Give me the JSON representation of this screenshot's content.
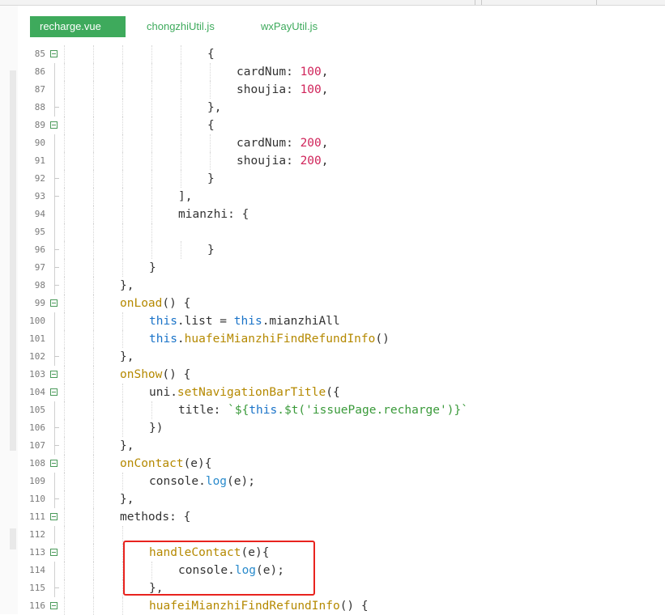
{
  "tabs": [
    {
      "label": "recharge.vue",
      "active": true
    },
    {
      "label": "chongzhiUtil.js",
      "active": false
    },
    {
      "label": "wxPayUtil.js",
      "active": false
    }
  ],
  "colors": {
    "tab_active_bg": "#3eaa5c",
    "number_literal": "#d0245a",
    "keyword_this": "#1a73c8",
    "method_name": "#b58900",
    "call_name": "#2a8bcc",
    "template_string": "#3a9a3a",
    "highlight_box": "#e8231e"
  },
  "editor": {
    "lines": [
      {
        "n": "85",
        "fold": true,
        "indent": 6,
        "tokens": [
          {
            "t": "{",
            "c": "plain"
          }
        ]
      },
      {
        "n": "86",
        "fold": false,
        "indent": 7,
        "tokens": [
          {
            "t": "cardNum: ",
            "c": "plain"
          },
          {
            "t": "100",
            "c": "num"
          },
          {
            "t": ",",
            "c": "plain"
          }
        ]
      },
      {
        "n": "87",
        "fold": false,
        "indent": 7,
        "tokens": [
          {
            "t": "shoujia: ",
            "c": "plain"
          },
          {
            "t": "100",
            "c": "num"
          },
          {
            "t": ",",
            "c": "plain"
          }
        ]
      },
      {
        "n": "88",
        "fold": false,
        "foldend": true,
        "indent": 6,
        "tokens": [
          {
            "t": "},",
            "c": "plain"
          }
        ]
      },
      {
        "n": "89",
        "fold": true,
        "indent": 6,
        "tokens": [
          {
            "t": "{",
            "c": "plain"
          }
        ]
      },
      {
        "n": "90",
        "fold": false,
        "indent": 7,
        "tokens": [
          {
            "t": "cardNum: ",
            "c": "plain"
          },
          {
            "t": "200",
            "c": "num"
          },
          {
            "t": ",",
            "c": "plain"
          }
        ]
      },
      {
        "n": "91",
        "fold": false,
        "indent": 7,
        "tokens": [
          {
            "t": "shoujia: ",
            "c": "plain"
          },
          {
            "t": "200",
            "c": "num"
          },
          {
            "t": ",",
            "c": "plain"
          }
        ]
      },
      {
        "n": "92",
        "fold": false,
        "foldend": true,
        "indent": 6,
        "tokens": [
          {
            "t": "}",
            "c": "plain"
          }
        ]
      },
      {
        "n": "93",
        "fold": false,
        "foldend": true,
        "indent": 5,
        "tokens": [
          {
            "t": "],",
            "c": "plain"
          }
        ]
      },
      {
        "n": "94",
        "fold": false,
        "indent": 5,
        "tokens": [
          {
            "t": "mianzhi: {",
            "c": "plain"
          }
        ]
      },
      {
        "n": "95",
        "fold": false,
        "indent": 5,
        "tokens": []
      },
      {
        "n": "96",
        "fold": false,
        "foldend": true,
        "indent": 6,
        "tokens": [
          {
            "t": "}",
            "c": "plain"
          }
        ]
      },
      {
        "n": "97",
        "fold": false,
        "foldend": true,
        "indent": 4,
        "tokens": [
          {
            "t": "}",
            "c": "plain"
          }
        ]
      },
      {
        "n": "98",
        "fold": false,
        "foldend": true,
        "indent": 3,
        "tokens": [
          {
            "t": "},",
            "c": "plain"
          }
        ]
      },
      {
        "n": "99",
        "fold": true,
        "indent": 3,
        "tokens": [
          {
            "t": "onLoad",
            "c": "method"
          },
          {
            "t": "() {",
            "c": "plain"
          }
        ]
      },
      {
        "n": "100",
        "fold": false,
        "indent": 4,
        "tokens": [
          {
            "t": "this",
            "c": "kw"
          },
          {
            "t": ".list = ",
            "c": "plain"
          },
          {
            "t": "this",
            "c": "kw"
          },
          {
            "t": ".mianzhiAll",
            "c": "plain"
          }
        ]
      },
      {
        "n": "101",
        "fold": false,
        "indent": 4,
        "tokens": [
          {
            "t": "this",
            "c": "kw"
          },
          {
            "t": ".",
            "c": "plain"
          },
          {
            "t": "huafeiMianzhiFindRefundInfo",
            "c": "method"
          },
          {
            "t": "()",
            "c": "plain"
          }
        ]
      },
      {
        "n": "102",
        "fold": false,
        "foldend": true,
        "indent": 3,
        "tokens": [
          {
            "t": "},",
            "c": "plain"
          }
        ]
      },
      {
        "n": "103",
        "fold": true,
        "indent": 3,
        "tokens": [
          {
            "t": "onShow",
            "c": "method"
          },
          {
            "t": "() {",
            "c": "plain"
          }
        ]
      },
      {
        "n": "104",
        "fold": true,
        "indent": 4,
        "tokens": [
          {
            "t": "uni.",
            "c": "plain"
          },
          {
            "t": "setNavigationBarTitle",
            "c": "method"
          },
          {
            "t": "({",
            "c": "plain"
          }
        ]
      },
      {
        "n": "105",
        "fold": false,
        "indent": 5,
        "tokens": [
          {
            "t": "title: ",
            "c": "plain"
          },
          {
            "t": "`${",
            "c": "str"
          },
          {
            "t": "this",
            "c": "kw"
          },
          {
            "t": ".$t(",
            "c": "str"
          },
          {
            "t": "'issuePage.recharge'",
            "c": "str"
          },
          {
            "t": ")}`",
            "c": "str"
          }
        ]
      },
      {
        "n": "106",
        "fold": false,
        "foldend": true,
        "indent": 4,
        "tokens": [
          {
            "t": "})",
            "c": "plain"
          }
        ]
      },
      {
        "n": "107",
        "fold": false,
        "foldend": true,
        "indent": 3,
        "tokens": [
          {
            "t": "},",
            "c": "plain"
          }
        ]
      },
      {
        "n": "108",
        "fold": true,
        "indent": 3,
        "tokens": [
          {
            "t": "onContact",
            "c": "method"
          },
          {
            "t": "(e){",
            "c": "plain"
          }
        ]
      },
      {
        "n": "109",
        "fold": false,
        "indent": 4,
        "tokens": [
          {
            "t": "console.",
            "c": "plain"
          },
          {
            "t": "log",
            "c": "call"
          },
          {
            "t": "(e);",
            "c": "plain"
          }
        ]
      },
      {
        "n": "110",
        "fold": false,
        "foldend": true,
        "indent": 3,
        "tokens": [
          {
            "t": "},",
            "c": "plain"
          }
        ]
      },
      {
        "n": "111",
        "fold": true,
        "indent": 3,
        "tokens": [
          {
            "t": "methods: {",
            "c": "plain"
          }
        ]
      },
      {
        "n": "112",
        "fold": false,
        "indent": 4,
        "tokens": []
      },
      {
        "n": "113",
        "fold": true,
        "indent": 4,
        "tokens": [
          {
            "t": "handleContact",
            "c": "method"
          },
          {
            "t": "(e){",
            "c": "plain"
          }
        ]
      },
      {
        "n": "114",
        "fold": false,
        "indent": 5,
        "tokens": [
          {
            "t": "console.",
            "c": "plain"
          },
          {
            "t": "log",
            "c": "call"
          },
          {
            "t": "(e);",
            "c": "plain"
          }
        ]
      },
      {
        "n": "115",
        "fold": false,
        "foldend": true,
        "indent": 4,
        "tokens": [
          {
            "t": "},",
            "c": "plain"
          }
        ]
      },
      {
        "n": "116",
        "fold": true,
        "indent": 4,
        "tokens": [
          {
            "t": "huafeiMianzhiFindRefundInfo",
            "c": "method"
          },
          {
            "t": "() {",
            "c": "plain"
          }
        ]
      }
    ]
  }
}
